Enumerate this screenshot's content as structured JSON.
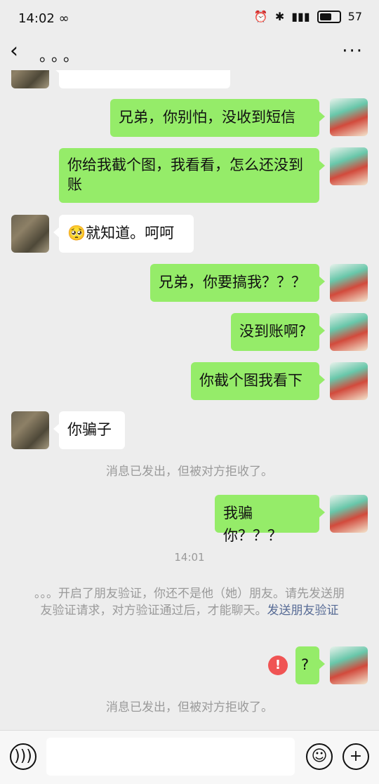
{
  "status_bar": {
    "time": "14:02",
    "infinity": "∞",
    "battery": "57"
  },
  "header": {
    "back": "‹",
    "title": "。。。",
    "more": "···"
  },
  "messages": {
    "m1": "兄弟，你别怕，没收到短信",
    "m2": "你给我截个图，我看看，怎么还没到账",
    "m3": "🥺就知道。呵呵",
    "m4": "兄弟，你要搞我？？？",
    "m5": "没到账啊?",
    "m6": "你截个图我看下",
    "m7": "你骗子",
    "m8": "我骗你？？？",
    "m9": "?"
  },
  "system": {
    "rejected1": "消息已发出，但被对方拒收了。",
    "timestamp": "14:01",
    "verify_text": "。。。开启了朋友验证，你还不是他（她）朋友。请先发送朋友验证请求，对方验证通过后，才能聊天。",
    "verify_link": "发送朋友验证",
    "rejected2": "消息已发出，但被对方拒收了。"
  },
  "error_icon": "!",
  "toolbar": {
    "voice_icon": "voice-icon",
    "emoji_icon": "emoji-icon",
    "plus_icon": "plus-icon"
  }
}
